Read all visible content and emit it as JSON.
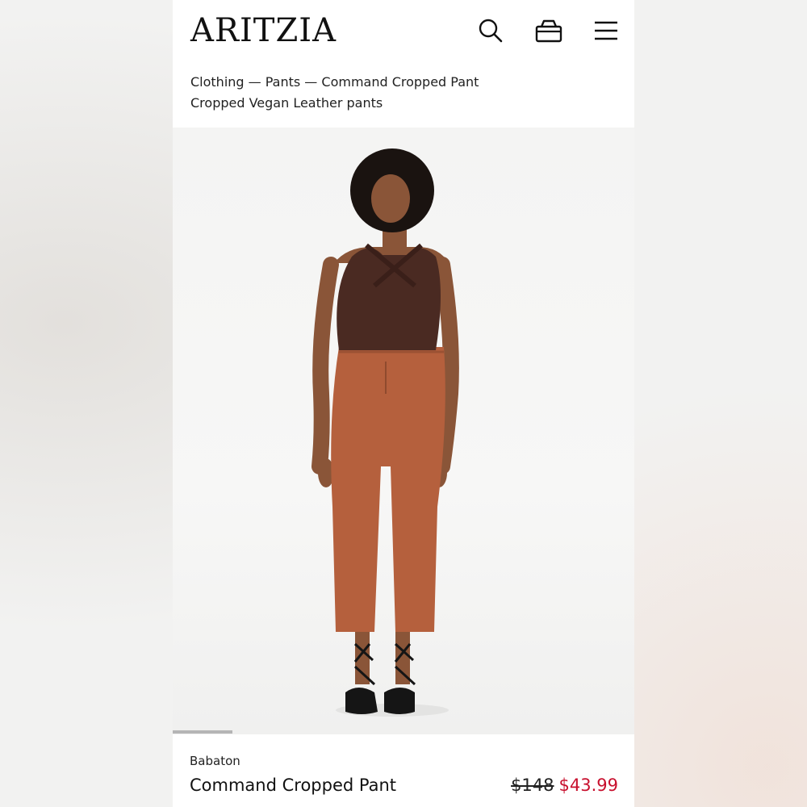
{
  "header": {
    "logo": "ARITZIA",
    "icons": [
      "search-icon",
      "bag-icon",
      "menu-icon"
    ]
  },
  "breadcrumbs": {
    "path": "Clothing — Pants — Command Cropped Pant",
    "subtitle": "Cropped Vegan Leather pants"
  },
  "gallery": {
    "image_description_icon": "model-photo",
    "progress": 0.13,
    "colors": {
      "top": "#4a2a22",
      "pants": "#b5603d",
      "sandals": "#151515",
      "skin": "#8a5538",
      "hair": "#1a1310"
    }
  },
  "product": {
    "brand": "Babaton",
    "name": "Command Cropped Pant",
    "original_price": "$148",
    "sale_price": "$43.99",
    "sale_color": "#c8102e"
  }
}
